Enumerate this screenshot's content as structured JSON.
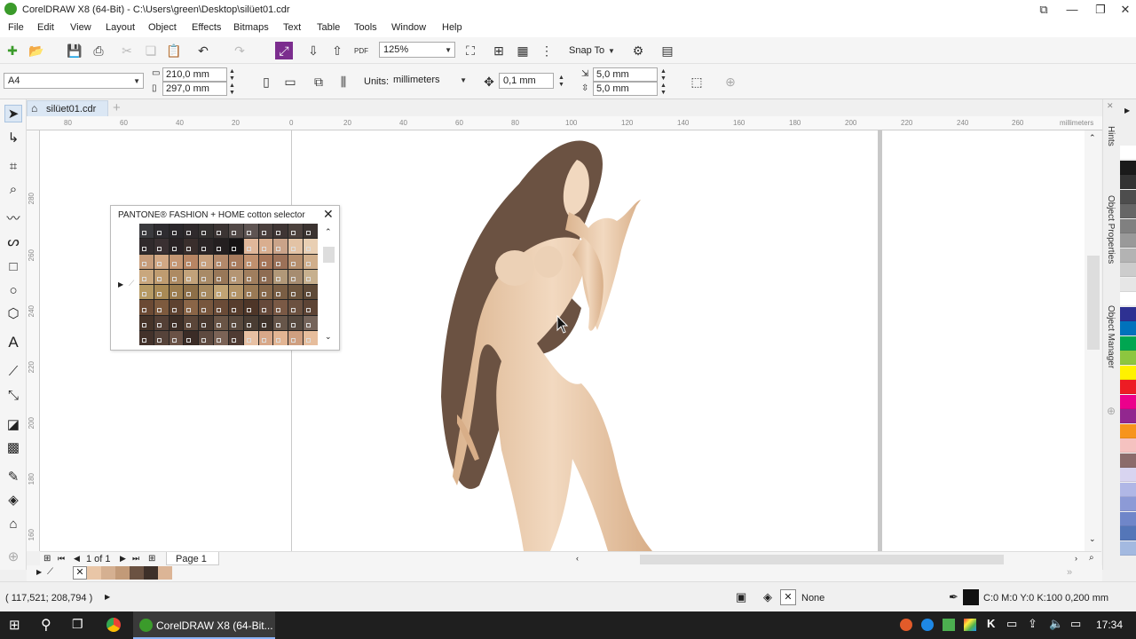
{
  "titlebar": {
    "title": "CorelDRAW X8 (64-Bit) - C:\\Users\\green\\Desktop\\silüet01.cdr"
  },
  "menu": [
    "File",
    "Edit",
    "View",
    "Layout",
    "Object",
    "Effects",
    "Bitmaps",
    "Text",
    "Table",
    "Tools",
    "Window",
    "Help"
  ],
  "toolbar": {
    "zoom": "125%",
    "snap_label": "Snap To"
  },
  "propbar": {
    "page_size": "A4",
    "width": "210,0 mm",
    "height": "297,0 mm",
    "units_label": "Units:",
    "units_value": "millimeters",
    "nudge": "0,1 mm",
    "dup_x": "5,0 mm",
    "dup_y": "5,0 mm"
  },
  "document_tab": "silüet01.cdr",
  "ruler": {
    "h_labels": [
      "80",
      "60",
      "40",
      "20",
      "0",
      "20",
      "40",
      "60",
      "80",
      "100",
      "120",
      "140",
      "160",
      "180",
      "200",
      "220",
      "240",
      "260"
    ],
    "units": "millimeters",
    "v_labels": [
      "280",
      "260",
      "240",
      "220",
      "200",
      "180",
      "160"
    ]
  },
  "pantone": {
    "title": "PANTONE® FASHION + HOME cotton selector",
    "rows": [
      [
        "#3a3a3e",
        "#2e2c30",
        "#2a272b",
        "#2f2a2c",
        "#33302f",
        "#3b3433",
        "#514846",
        "#5e5452",
        "#4a3f3d",
        "#3f3534",
        "#4c413d",
        "#3b3330"
      ],
      [
        "#302a2c",
        "#3a3032",
        "#2a2225",
        "#3a2e2c",
        "#2b2526",
        "#241f20",
        "#161314",
        "#e0b79a",
        "#d9ae8f",
        "#caa389",
        "#e3c3a5",
        "#e9cfb3"
      ],
      [
        "#c69c7a",
        "#d2a884",
        "#c59673",
        "#b88563",
        "#c7a07d",
        "#b3896a",
        "#a97c5e",
        "#c0906e",
        "#a67558",
        "#9c7158",
        "#b58e6d",
        "#d0ae8b"
      ],
      [
        "#c9a77d",
        "#bf9c70",
        "#ad8a62",
        "#c2a27a",
        "#a88a66",
        "#987758",
        "#b49573",
        "#a07e5e",
        "#8e6c52",
        "#b19878",
        "#a68c70",
        "#c7b08e"
      ],
      [
        "#b69a64",
        "#a98a55",
        "#9b7c4e",
        "#8d6f48",
        "#a6895f",
        "#c1a474",
        "#b39467",
        "#9a7a55",
        "#87684a",
        "#7a5e44",
        "#6e563f",
        "#5f4a38"
      ],
      [
        "#6b4a34",
        "#7d5a3e",
        "#5e4230",
        "#8a6547",
        "#77563d",
        "#6a4b37",
        "#573d2d",
        "#4e3628",
        "#65493a",
        "#7a5945",
        "#6b5140",
        "#5d4435"
      ],
      [
        "#463429",
        "#544036",
        "#3e2f27",
        "#5b4639",
        "#4a3a30",
        "#6a5546",
        "#5a4a3e",
        "#4a3d33",
        "#3f332b",
        "#67564a",
        "#574a40",
        "#75645a"
      ],
      [
        "#43322b",
        "#56433a",
        "#6a5246",
        "#3b2c26",
        "#5e4a40",
        "#7b6356",
        "#4f3b33",
        "#e7c0a3",
        "#d8a889",
        "#e3b593",
        "#cf9f80",
        "#e6bd9c"
      ]
    ]
  },
  "page_nav": {
    "count": "1 of 1",
    "page_tab": "Page 1"
  },
  "doc_palette": [
    "#e9c6a7",
    "#d5b091",
    "#c29a78",
    "#6b5242",
    "#3e3029",
    "#dcb596"
  ],
  "dockers": [
    "Hints",
    "Object Properties",
    "Object Manager"
  ],
  "color_palette": [
    "#ffffff",
    "#1a1a1a",
    "#333333",
    "#4d4d4d",
    "#666666",
    "#808080",
    "#999999",
    "#b3b3b3",
    "#cccccc",
    "#e6e6e6",
    "#ffffff",
    "#2e3192",
    "#0072bc",
    "#00a651",
    "#8dc63f",
    "#fff200",
    "#ed1c24",
    "#ec008c",
    "#92278f",
    "#f7941d",
    "#f5c2c0",
    "#8b6b6b",
    "#d8d4f0",
    "#b0b7e6",
    "#8c9ad6",
    "#6f86c9",
    "#5476b8",
    "#a3b9e0"
  ],
  "status": {
    "coords": "( 117,521; 208,794 )",
    "fill": "None",
    "outline": "C:0 M:0 Y:0 K:100  0,200 mm"
  },
  "taskbar": {
    "app": "CorelDRAW X8 (64-Bit...",
    "time": "17:34"
  },
  "colors": {
    "accent": "#3b9b2b",
    "hair": "#6b5242",
    "skin": "#dcb596"
  }
}
